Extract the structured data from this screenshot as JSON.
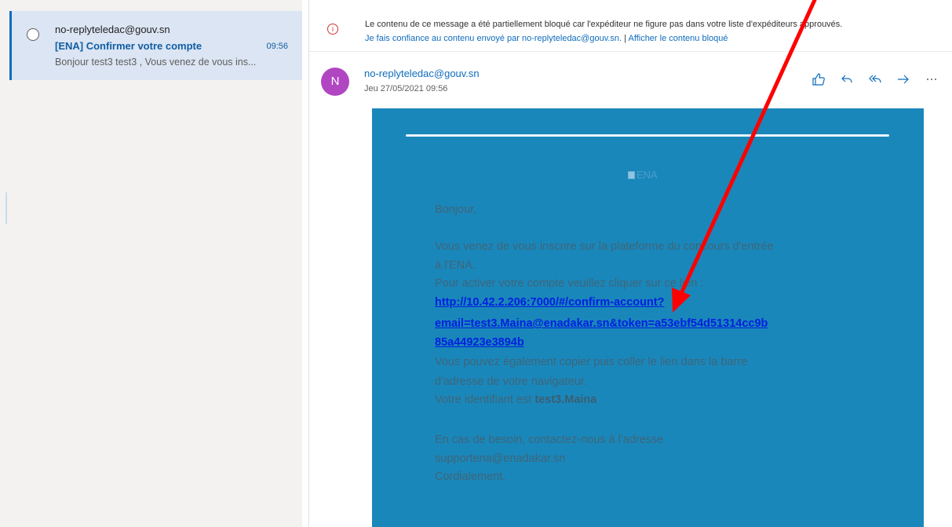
{
  "message_list": {
    "items": [
      {
        "sender": "no-replyteledac@gouv.sn",
        "subject": "[ENA] Confirmer votre compte",
        "time": "09:56",
        "preview": "Bonjour test3 test3 , Vous venez de vous ins..."
      }
    ]
  },
  "reading_pane": {
    "info_bar": {
      "line1": "Le contenu de ce message a été partiellement bloqué car l'expéditeur ne figure pas dans votre liste d'expéditeurs approuvés.",
      "trust_link": "Je fais confiance au contenu envoyé par no-replyteledac@gouv.sn.",
      "separator": "|",
      "show_blocked_link": "Afficher le contenu bloqué"
    },
    "header": {
      "avatar_initial": "N",
      "avatar_color": "#b146c2",
      "from": "no-replyteledac@gouv.sn",
      "date": "Jeu 27/05/2021 09:56"
    },
    "actions": [
      "like-icon",
      "reply-icon",
      "reply-all-icon",
      "forward-icon",
      "more-icon"
    ],
    "body": {
      "background_color": "#1a87bb",
      "logo_alt": "ENA",
      "greeting": "Bonjour,",
      "line1": "Vous venez de vous inscrire sur la plateforme du concours d'entrée",
      "line2": "à l'ENA.",
      "line3": "Pour activer votre compte veuillez cliquer sur ce lien :",
      "link_line1": "http://10.42.2.206:7000/#/confirm-account?",
      "link_line2": "email=test3.Maina@enadakar.sn&token=a53ebf54d51314cc9b",
      "link_line3": "85a44923e3894b",
      "line4": "Vous pouvez également copier puis coller le lien dans la barre",
      "line5": "d'adresse de votre navigateur.",
      "identifier_prefix": "Votre identifiant est",
      "identifier": "test3.Maina",
      "line6": "En cas de besoin, contactez-nous à l'adresse",
      "support_email": "supportena@enadakar.sn",
      "closing": "Cordialement."
    }
  },
  "annotation": {
    "arrow_color": "#ff0000"
  }
}
